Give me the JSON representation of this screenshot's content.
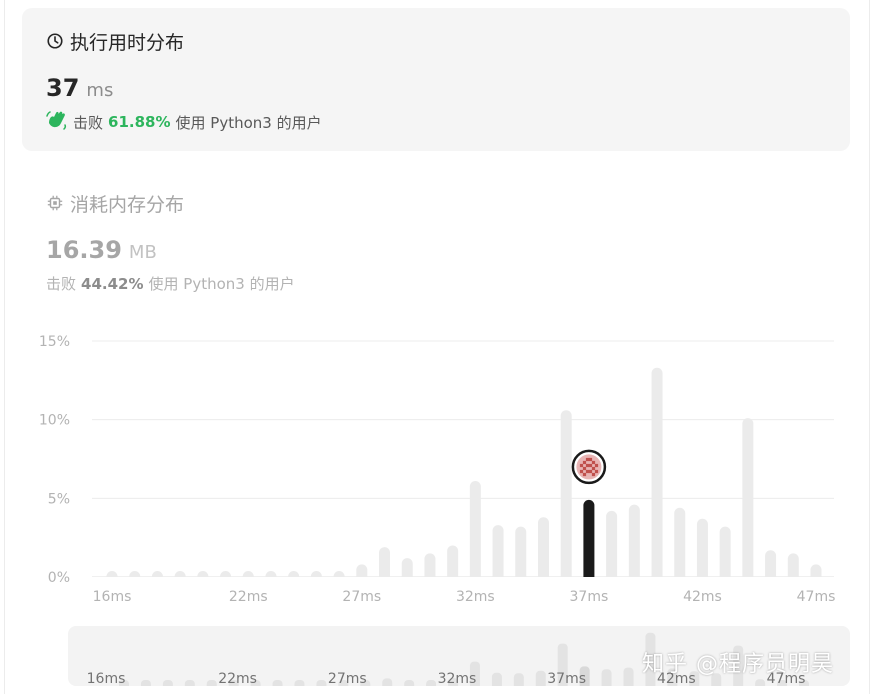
{
  "runtime": {
    "title": "执行用时分布",
    "value": "37",
    "unit": "ms",
    "beats_prefix": "击败",
    "beats_pct": "61.88%",
    "beats_suffix": "使用 Python3 的用户"
  },
  "memory": {
    "title": "消耗内存分布",
    "value": "16.39",
    "unit": "MB",
    "beats_prefix": "击败",
    "beats_pct": "44.42%",
    "beats_suffix": "使用 Python3 的用户"
  },
  "watermark": "知乎 @程序员明昊",
  "icons": {
    "runtime": "clock-icon",
    "memory": "chip-icon",
    "beats": "clapping-hand-icon",
    "marker": "user-avatar-icon"
  },
  "colors": {
    "accent_green": "#2db55d",
    "bar_default": "#ebebeb",
    "bar_highlight": "#1a1a1a"
  },
  "chart_data": {
    "type": "bar",
    "x": [
      16,
      17,
      18,
      19,
      20,
      21,
      22,
      23,
      24,
      25,
      26,
      27,
      28,
      29,
      30,
      31,
      32,
      33,
      34,
      35,
      36,
      37,
      38,
      39,
      40,
      41,
      42,
      43,
      44,
      45,
      46,
      47
    ],
    "values": [
      0.3,
      0.3,
      0.3,
      0.3,
      0.3,
      0.3,
      0.3,
      0.3,
      0.3,
      0.3,
      0.3,
      0.8,
      1.9,
      1.2,
      1.5,
      2.0,
      6.1,
      3.3,
      3.2,
      3.8,
      10.6,
      4.9,
      4.2,
      4.6,
      13.3,
      4.4,
      3.7,
      3.2,
      10.1,
      1.7,
      1.5,
      0.8
    ],
    "highlight_x": 37,
    "xticks": [
      "16ms",
      "22ms",
      "27ms",
      "32ms",
      "37ms",
      "42ms",
      "47ms"
    ],
    "yticks": [
      "0%",
      "5%",
      "10%",
      "15%"
    ],
    "ylim": [
      0,
      15
    ],
    "grid": true
  },
  "brush_ticks": [
    "16ms",
    "22ms",
    "27ms",
    "32ms",
    "37ms",
    "42ms",
    "47ms"
  ]
}
